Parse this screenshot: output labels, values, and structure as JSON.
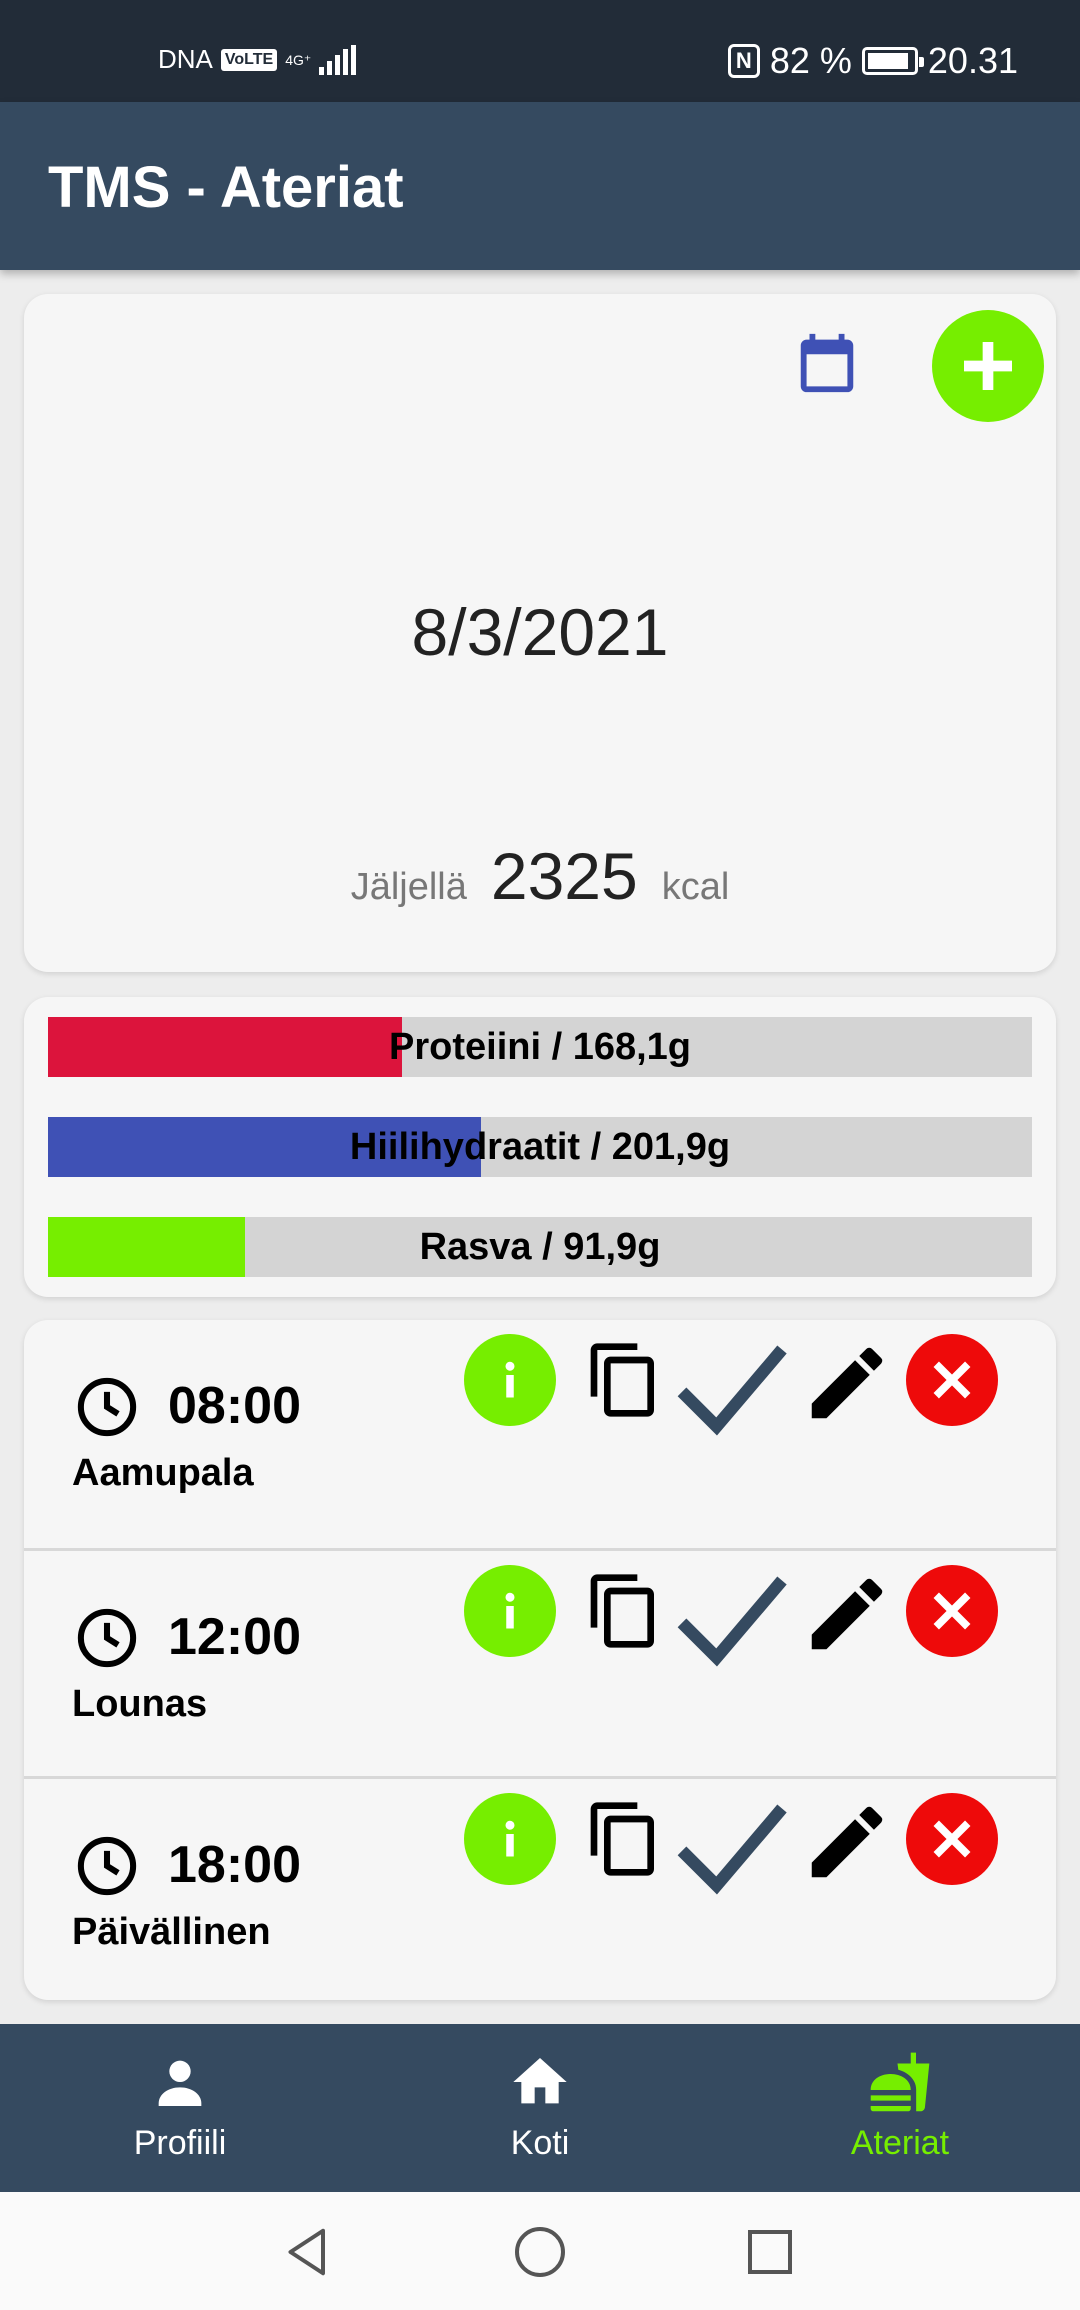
{
  "status_bar": {
    "carrier": "DNA",
    "volte": "VoLTE",
    "network": "4G⁺",
    "battery_percent": "82 %",
    "time": "20.31"
  },
  "app_bar": {
    "title": "TMS - Ateriat"
  },
  "day_card": {
    "date": "8/3/2021",
    "remaining_label": "Jäljellä",
    "remaining_value": "2325",
    "remaining_unit": "kcal",
    "calendar_icon": "calendar-icon",
    "add_icon": "plus-icon"
  },
  "macros": [
    {
      "label": "Proteiini  / 168,1g",
      "progress": 0.36,
      "color": "#dc143c"
    },
    {
      "label": "Hiilihydraatit  / 201,9g",
      "progress": 0.44,
      "color": "#3f51b5"
    },
    {
      "label": "Rasva  / 91,9g",
      "progress": 0.2,
      "color": "#76ee00"
    }
  ],
  "meals": [
    {
      "time": "08:00",
      "name": "Aamupala"
    },
    {
      "time": "12:00",
      "name": "Lounas"
    },
    {
      "time": "18:00",
      "name": "Päivällinen"
    }
  ],
  "meal_actions": [
    "info-icon",
    "copy-icon",
    "check-icon",
    "edit-icon",
    "delete-icon"
  ],
  "bottom_nav": {
    "items": [
      {
        "label": "Profiili",
        "icon": "person-icon"
      },
      {
        "label": "Koti",
        "icon": "home-icon"
      },
      {
        "label": "Ateriat",
        "icon": "meal-icon"
      }
    ],
    "active": "Ateriat"
  },
  "colors": {
    "header": "#354a60",
    "status_bar": "#222c38",
    "accent_green": "#76ee00",
    "delete_red": "#ee0a0a",
    "calendar_blue": "#3f51b5"
  }
}
